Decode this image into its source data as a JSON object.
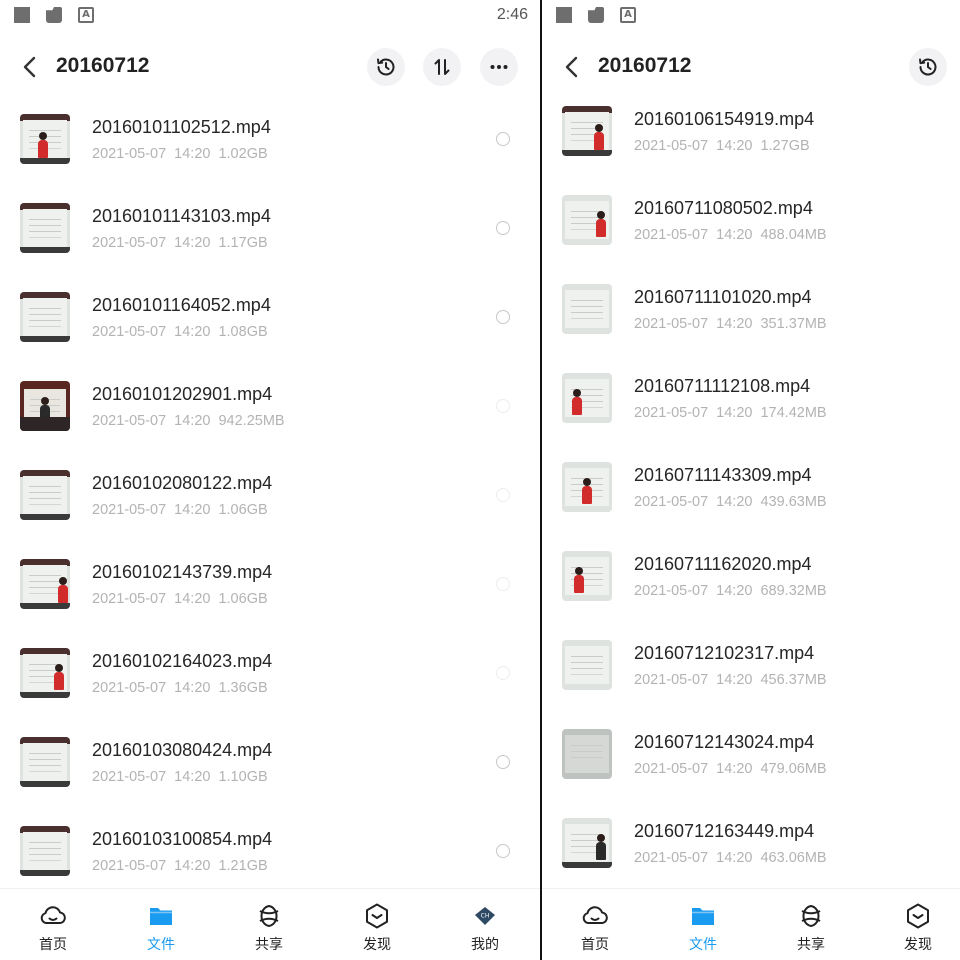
{
  "left": {
    "status": {
      "time": "2:46",
      "icons": [
        "square-icon",
        "folder-icon",
        "a-box-icon"
      ]
    },
    "header": {
      "title": "20160712",
      "buttons": [
        "history-icon",
        "sort-icon",
        "more-icon"
      ]
    },
    "files": [
      {
        "name": "20160101102512.mp4",
        "date": "2021-05-07",
        "time": "14:20",
        "size": "1.02GB",
        "thumb": "board-person-left"
      },
      {
        "name": "20160101143103.mp4",
        "date": "2021-05-07",
        "time": "14:20",
        "size": "1.17GB",
        "thumb": "board"
      },
      {
        "name": "20160101164052.mp4",
        "date": "2021-05-07",
        "time": "14:20",
        "size": "1.08GB",
        "thumb": "board"
      },
      {
        "name": "20160101202901.mp4",
        "date": "2021-05-07",
        "time": "14:20",
        "size": "942.25MB",
        "thumb": "hall"
      },
      {
        "name": "20160102080122.mp4",
        "date": "2021-05-07",
        "time": "14:20",
        "size": "1.06GB",
        "thumb": "board"
      },
      {
        "name": "20160102143739.mp4",
        "date": "2021-05-07",
        "time": "14:20",
        "size": "1.06GB",
        "thumb": "board-person-right"
      },
      {
        "name": "20160102164023.mp4",
        "date": "2021-05-07",
        "time": "14:20",
        "size": "1.36GB",
        "thumb": "board-person-right"
      },
      {
        "name": "20160103080424.mp4",
        "date": "2021-05-07",
        "time": "14:20",
        "size": "1.10GB",
        "thumb": "board"
      },
      {
        "name": "20160103100854.mp4",
        "date": "2021-05-07",
        "time": "14:20",
        "size": "1.21GB",
        "thumb": "board"
      }
    ],
    "tabs": [
      {
        "label": "首页",
        "icon": "cloud-icon",
        "active": false
      },
      {
        "label": "文件",
        "icon": "folder-icon",
        "active": true
      },
      {
        "label": "共享",
        "icon": "share-knot-icon",
        "active": false
      },
      {
        "label": "发现",
        "icon": "discover-icon",
        "active": false
      },
      {
        "label": "我的",
        "icon": "profile-badge-icon",
        "active": false
      }
    ]
  },
  "right": {
    "status": {
      "icons": [
        "square-icon",
        "folder-icon",
        "a-box-icon"
      ]
    },
    "header": {
      "title": "20160712",
      "buttons": [
        "history-icon"
      ]
    },
    "files": [
      {
        "name": "20160106154919.mp4",
        "date": "2021-05-07",
        "time": "14:20",
        "size": "1.27GB",
        "thumb": "board-person-right"
      },
      {
        "name": "20160711080502.mp4",
        "date": "2021-05-07",
        "time": "14:20",
        "size": "488.04MB",
        "thumb": "board-person-right"
      },
      {
        "name": "20160711101020.mp4",
        "date": "2021-05-07",
        "time": "14:20",
        "size": "351.37MB",
        "thumb": "board"
      },
      {
        "name": "20160711112108.mp4",
        "date": "2021-05-07",
        "time": "14:20",
        "size": "174.42MB",
        "thumb": "board-person-left"
      },
      {
        "name": "20160711143309.mp4",
        "date": "2021-05-07",
        "time": "14:20",
        "size": "439.63MB",
        "thumb": "board-person-left"
      },
      {
        "name": "20160711162020.mp4",
        "date": "2021-05-07",
        "time": "14:20",
        "size": "689.32MB",
        "thumb": "board-person-left"
      },
      {
        "name": "20160712102317.mp4",
        "date": "2021-05-07",
        "time": "14:20",
        "size": "456.37MB",
        "thumb": "board"
      },
      {
        "name": "20160712143024.mp4",
        "date": "2021-05-07",
        "time": "14:20",
        "size": "479.06MB",
        "thumb": "board"
      },
      {
        "name": "20160712163449.mp4",
        "date": "2021-05-07",
        "time": "14:20",
        "size": "463.06MB",
        "thumb": "board-person-right"
      }
    ],
    "tabs": [
      {
        "label": "首页",
        "icon": "cloud-icon",
        "active": false
      },
      {
        "label": "文件",
        "icon": "folder-icon",
        "active": true
      },
      {
        "label": "共享",
        "icon": "share-knot-icon",
        "active": false
      },
      {
        "label": "发现",
        "icon": "discover-icon",
        "active": false
      }
    ]
  },
  "colors": {
    "accent": "#1a9bf0",
    "meta_text": "#b3b3b3",
    "divider": "#111111"
  }
}
